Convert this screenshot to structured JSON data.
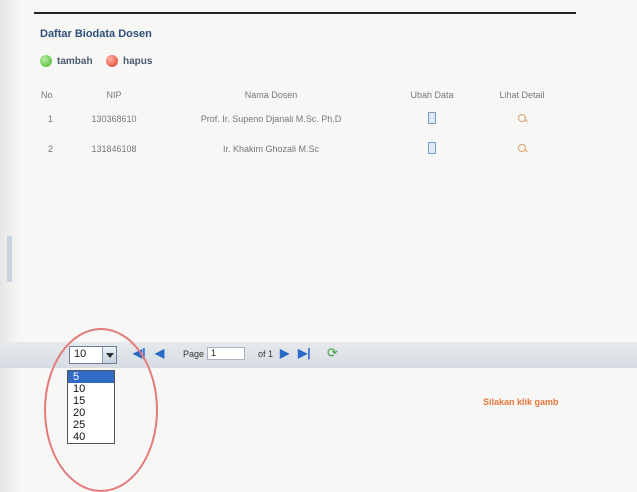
{
  "panel": {
    "title": "Daftar Biodata Dosen"
  },
  "toolbar": {
    "add_label": "tambah",
    "delete_label": "hapus"
  },
  "table": {
    "headers": [
      "No",
      "NIP",
      "Nama Dosen",
      "Ubah Data",
      "Lihat Detail"
    ],
    "rows": [
      {
        "no": "1",
        "nip": "130368610",
        "nama": "Prof. Ir. Supeno Djanali M.Sc. Ph.D"
      },
      {
        "no": "2",
        "nip": "131846108",
        "nama": "Ir. Khakim Ghozali M.Sc"
      }
    ]
  },
  "pager": {
    "page_size": "10",
    "page_label": "Page",
    "page_value": "1",
    "of_label": "of 1",
    "page_size_options": [
      "5",
      "10",
      "15",
      "20",
      "25",
      "40"
    ]
  },
  "hint": "Silakan klik gamb",
  "colors": {
    "oval": "#e57a7a",
    "hint": "#e8763c",
    "selected_option": "#316ac5"
  }
}
